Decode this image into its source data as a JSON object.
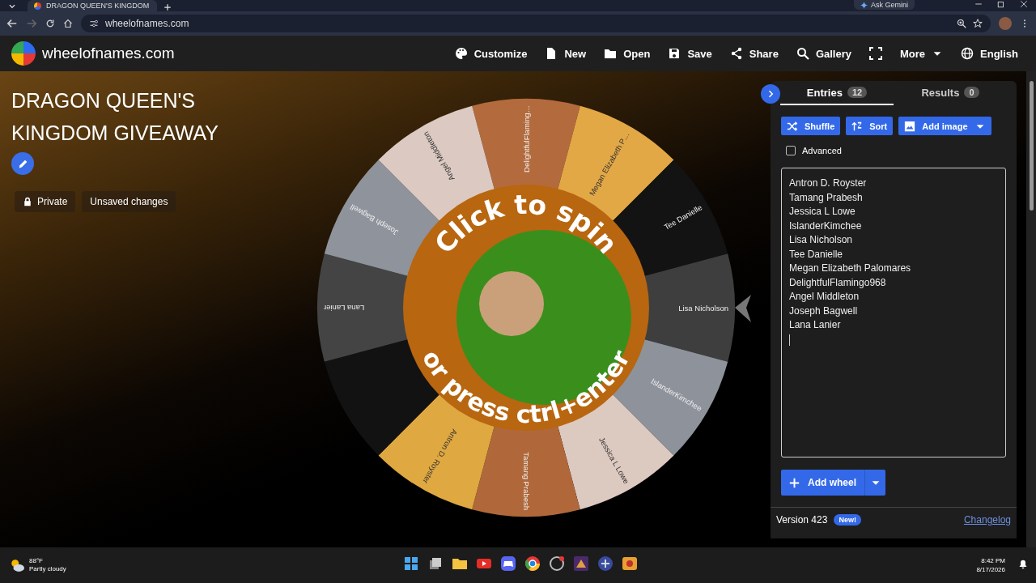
{
  "browser": {
    "tab_title": "DRAGON QUEEN'S KINGDOM",
    "ask_gemini": "Ask Gemini",
    "url": "wheelofnames.com"
  },
  "header": {
    "site_name": "wheelofnames.com",
    "nav": [
      {
        "label": "Customize"
      },
      {
        "label": "New"
      },
      {
        "label": "Open"
      },
      {
        "label": "Save"
      },
      {
        "label": "Share"
      },
      {
        "label": "Gallery"
      }
    ],
    "more": "More",
    "language": "English"
  },
  "wheel_info": {
    "title": "DRAGON QUEEN'S KINGDOM GIVEAWAY",
    "chips": [
      {
        "label": "Private",
        "kind": "private"
      },
      {
        "label": "Unsaved changes",
        "kind": "status"
      }
    ]
  },
  "wheel": {
    "prompt_top": "Click to spin",
    "prompt_bottom": "or press ctrl+enter",
    "segments": [
      {
        "label": "DelightfulFlaming…",
        "color": "#b36b3d"
      },
      {
        "label": "Megan Elizabeth P…",
        "color": "#e3a846"
      },
      {
        "label": "Tee Danielle",
        "color": "#131313"
      },
      {
        "label": "Lisa Nicholson",
        "color": "#3e3e3e"
      },
      {
        "label": "IslanderKimchee",
        "color": "#8e929b"
      },
      {
        "label": "Jessica L Lowe",
        "color": "#dcc9c0"
      },
      {
        "label": "Tamang Prabesh",
        "color": "#b0683a"
      },
      {
        "label": "Antron D. Royster",
        "color": "#e0a841"
      },
      {
        "color": "#121212"
      },
      {
        "label": "Lana Lanier",
        "color": "#444444"
      },
      {
        "label": "Joseph Bagwell",
        "color": "#8f939c"
      },
      {
        "label": "Angel Middleton",
        "color": "#dccac2"
      }
    ]
  },
  "panel": {
    "tabs": [
      {
        "label": "Entries",
        "count": "12",
        "selected": true
      },
      {
        "label": "Results",
        "count": "0",
        "selected": false
      }
    ],
    "buttons": [
      {
        "label": "Shuffle",
        "kind": "plain"
      },
      {
        "label": "Sort",
        "kind": "plain"
      },
      {
        "label": "Add image",
        "kind": "dropdown"
      }
    ],
    "advanced": {
      "label": "Advanced",
      "checked": false
    },
    "entries": [
      "Antron D. Royster",
      "Tamang Prabesh",
      "Jessica L Lowe",
      "IslanderKimchee",
      "Lisa Nicholson",
      "Tee Danielle",
      "Megan Elizabeth Palomares",
      "DelightfulFlamingo968",
      "Angel Middleton",
      "Joseph Bagwell",
      "Lana Lanier"
    ],
    "add_wheel": "Add wheel",
    "version": "Version 423",
    "new_badge": "New!",
    "changelog": "Changelog"
  },
  "taskbar": {
    "temperature": "88°F",
    "weather": "Partly cloudy",
    "time": "8:42 PM",
    "date": "8/17/2026"
  }
}
